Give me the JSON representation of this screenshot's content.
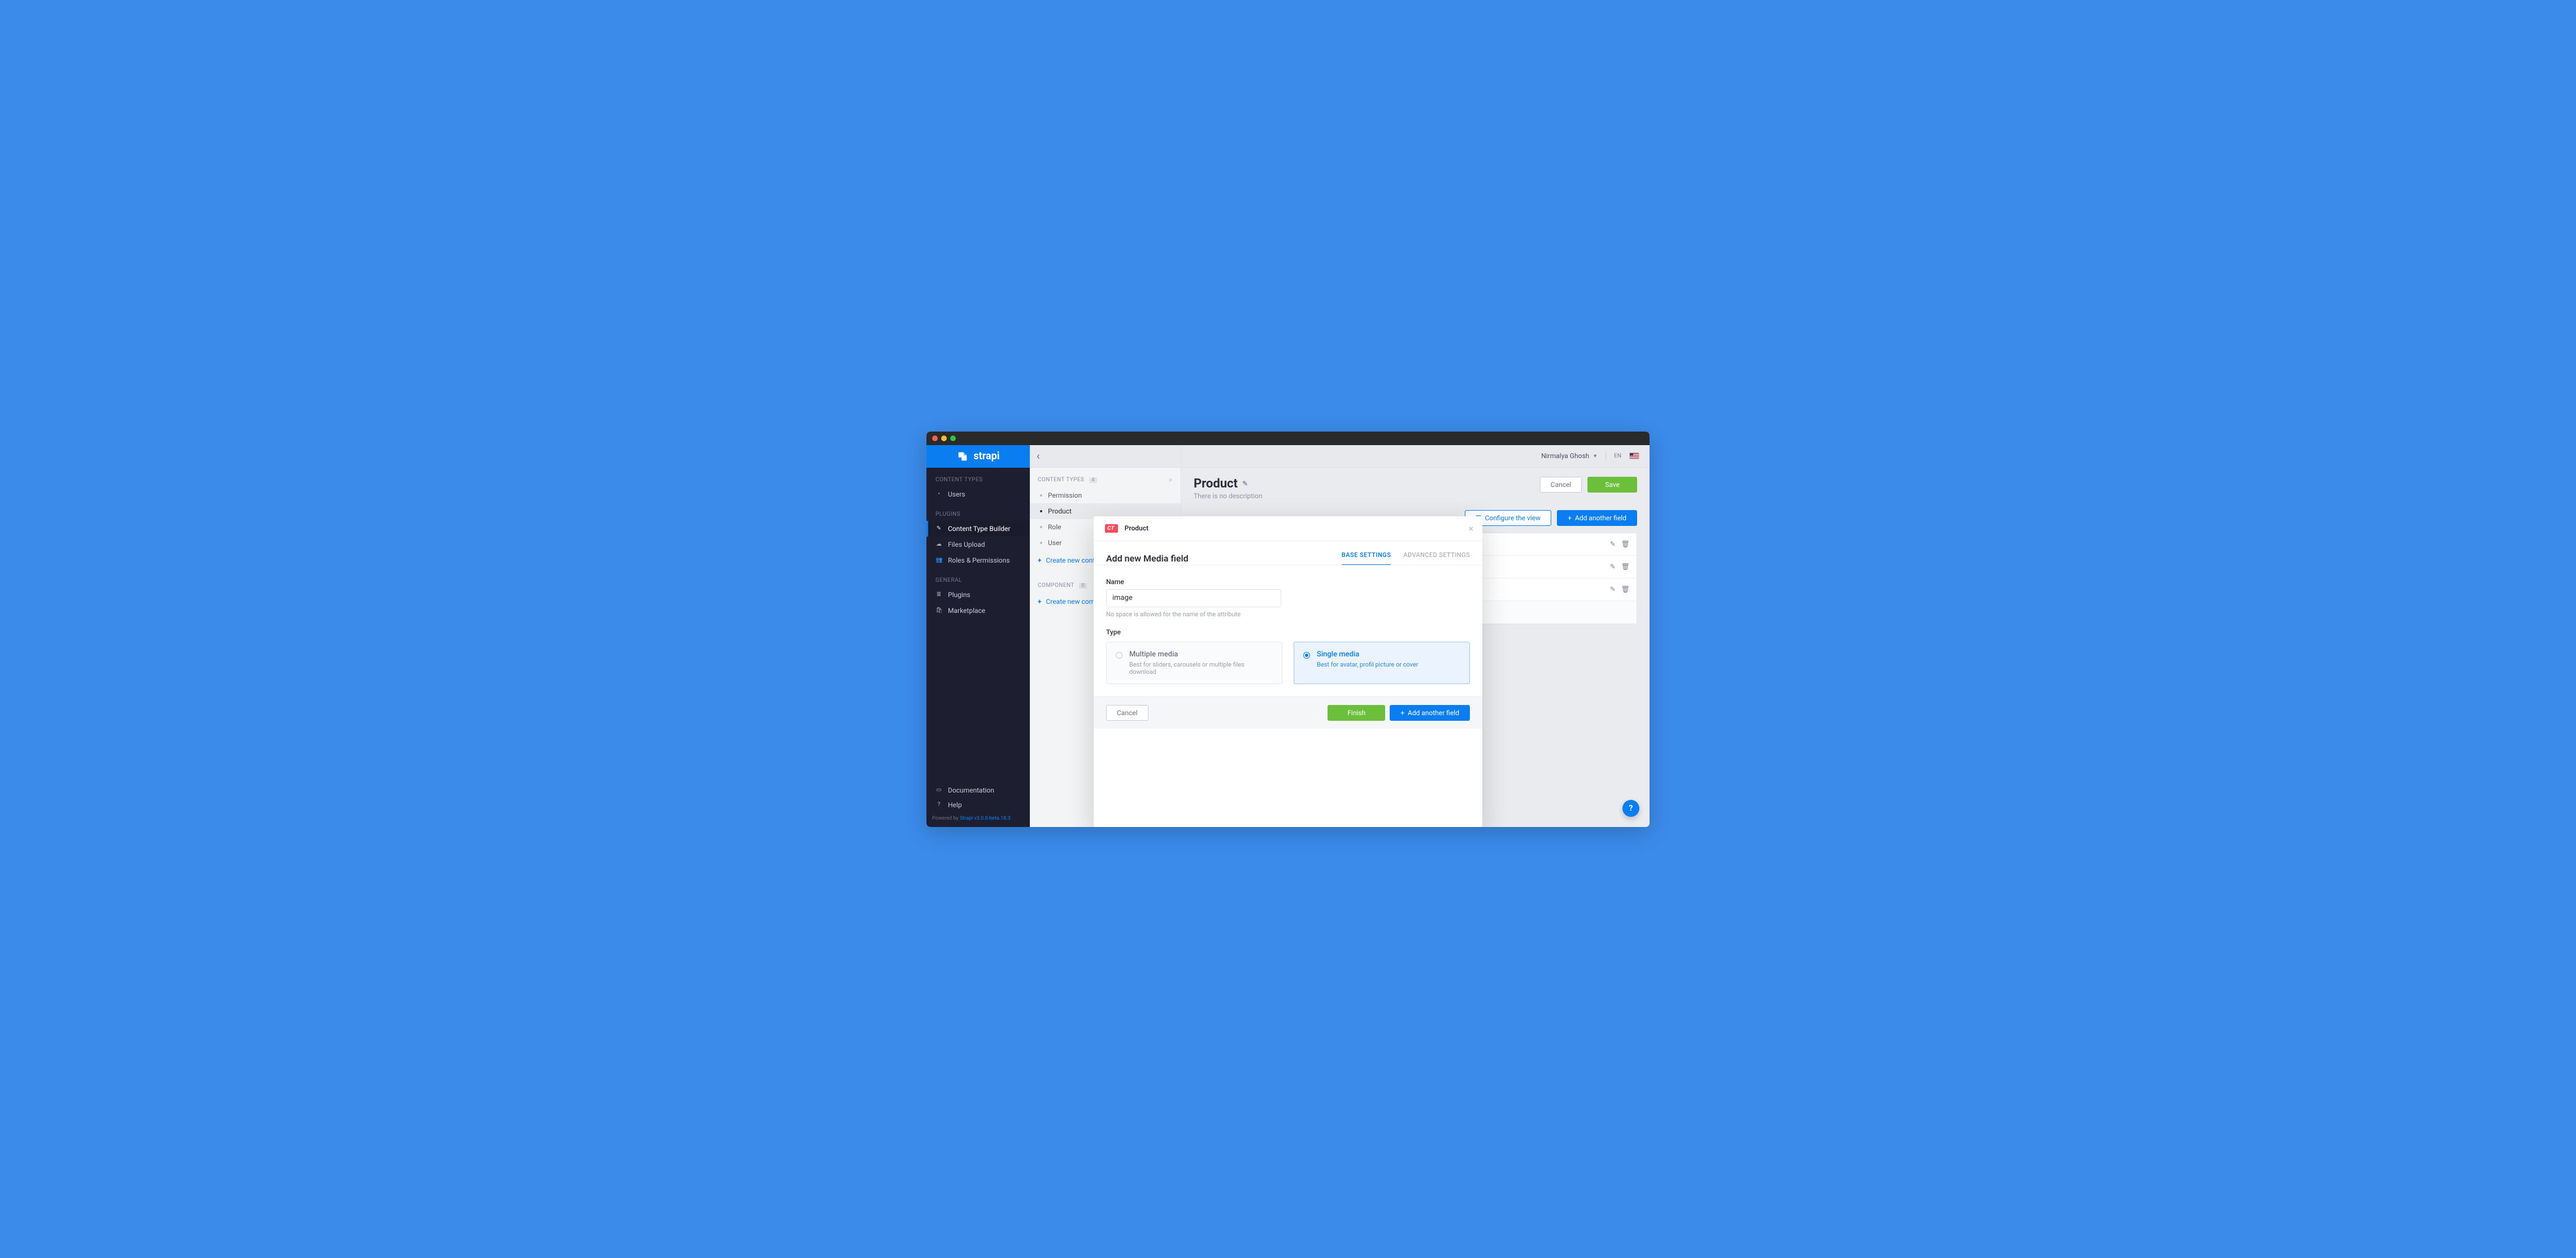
{
  "brand": "strapi",
  "sidebar": {
    "sections": [
      {
        "title": "CONTENT TYPES",
        "items": [
          {
            "icon": "•",
            "label": "Users"
          }
        ]
      },
      {
        "title": "PLUGINS",
        "items": [
          {
            "icon": "✎",
            "label": "Content Type Builder",
            "active": true
          },
          {
            "icon": "☁",
            "label": "Files Upload"
          },
          {
            "icon": "👥",
            "label": "Roles & Permissions"
          }
        ]
      },
      {
        "title": "GENERAL",
        "items": [
          {
            "icon": "≣",
            "label": "Plugins"
          },
          {
            "icon": "🛍",
            "label": "Marketplace"
          }
        ]
      }
    ],
    "footer": [
      {
        "icon": "▭",
        "label": "Documentation"
      },
      {
        "icon": "?",
        "label": "Help"
      }
    ],
    "powered_prefix": "Powered by ",
    "powered_link": "Strapi v3.0.0-beta.18.3"
  },
  "midpanel": {
    "groups": [
      {
        "title": "CONTENT TYPES",
        "count": "4",
        "items": [
          {
            "label": "Permission"
          },
          {
            "label": "Product",
            "active": true
          },
          {
            "label": "Role"
          },
          {
            "label": "User"
          }
        ],
        "create": "Create new content type"
      },
      {
        "title": "COMPONENT",
        "count": "0",
        "items": [],
        "create": "Create new component"
      }
    ]
  },
  "topbar": {
    "user": "Nirmalya Ghosh",
    "lang": "EN"
  },
  "main": {
    "title": "Product",
    "subtitle": "There is no description",
    "cancel": "Cancel",
    "save": "Save",
    "configure": "Configure the view",
    "add_field": "Add another field"
  },
  "modal": {
    "badge": "CT",
    "crumb": "Product",
    "heading": "Add new Media field",
    "tabs": {
      "base": "BASE SETTINGS",
      "adv": "ADVANCED SETTINGS"
    },
    "name_label": "Name",
    "name_value": "image",
    "name_hint": "No space is allowed for the name of the attribute",
    "type_label": "Type",
    "options": [
      {
        "title": "Multiple media",
        "sub": "Best for sliders, carousels or multiple files download",
        "selected": false
      },
      {
        "title": "Single media",
        "sub": "Best for avatar, profil picture or cover",
        "selected": true
      }
    ],
    "foot": {
      "cancel": "Cancel",
      "finish": "Finish",
      "add": "Add another field"
    }
  }
}
